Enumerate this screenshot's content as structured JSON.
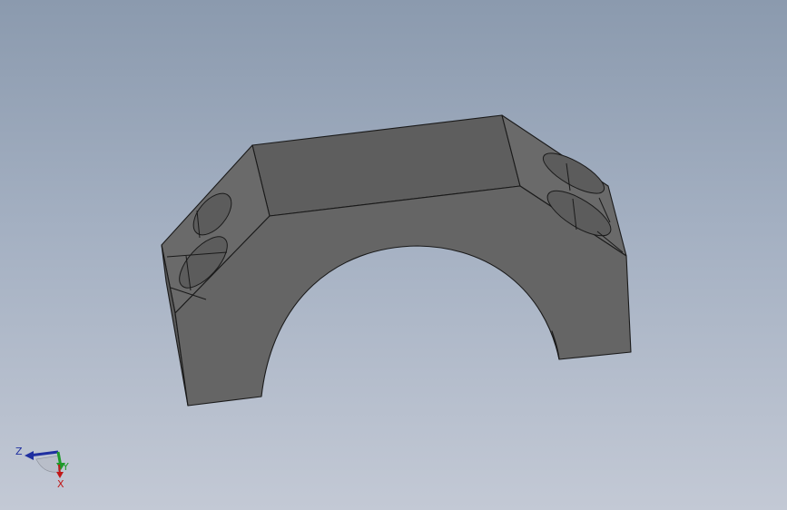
{
  "viewport": {
    "background_top": "#8b9aae",
    "background_bottom": "#c3c9d5",
    "part_face_color": "#666666",
    "part_edge_color": "#1a1a1a"
  },
  "triad": {
    "z_label": "Z",
    "y_label": "Y",
    "x_label": "X",
    "z_color": "#1f2fa0",
    "y_color": "#1e9a2a",
    "x_color": "#c01818"
  }
}
